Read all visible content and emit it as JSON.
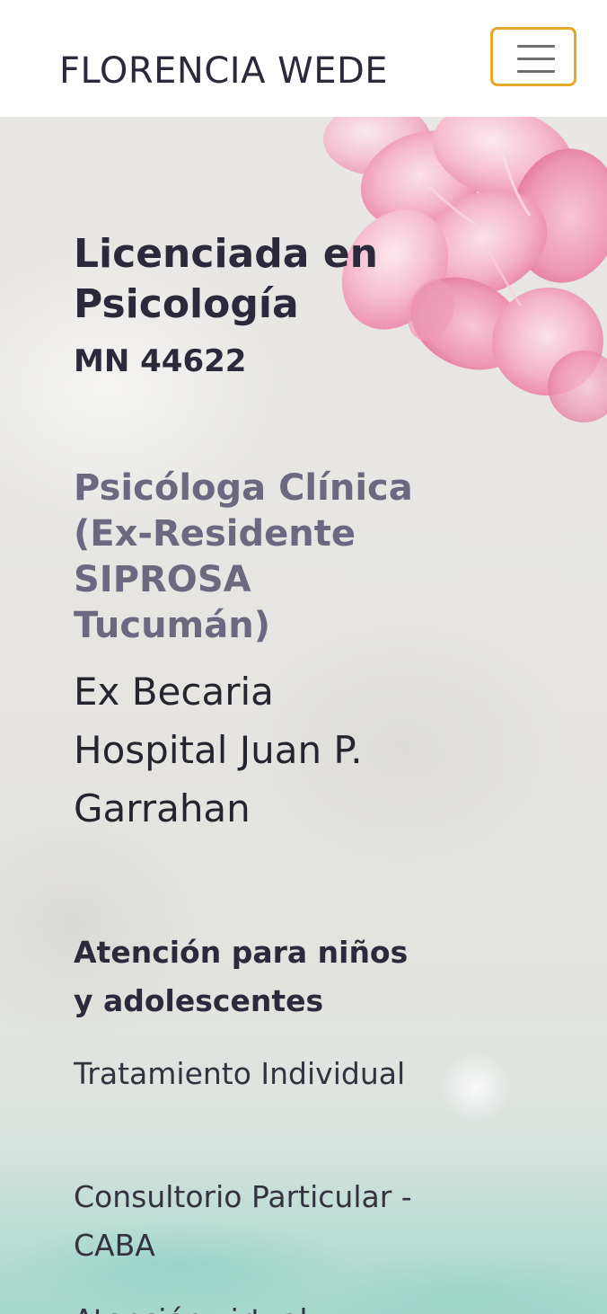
{
  "header": {
    "brand": "FLORENCIA WEDE",
    "menu_toggle_icon": "hamburger-menu-icon",
    "accent_color": "#e7a72a"
  },
  "hero": {
    "title": "Licenciada en Psicología",
    "license_number": "MN 44622",
    "clinical_title": "Psicóloga Clínica (Ex-Residente SIPROSA Tucumán)",
    "fellowship": "Ex Becaria Hospital Juan P. Garrahan",
    "services_heading": "Atención para niños y adolescentes",
    "services": [
      "Tratamiento Individual",
      "Consultorio Particular - CABA",
      "Atención virtual"
    ]
  },
  "colors": {
    "text_dark": "#2b2a3a",
    "text_muted": "#6a6980",
    "flower_pink": "#f2a6c2"
  }
}
